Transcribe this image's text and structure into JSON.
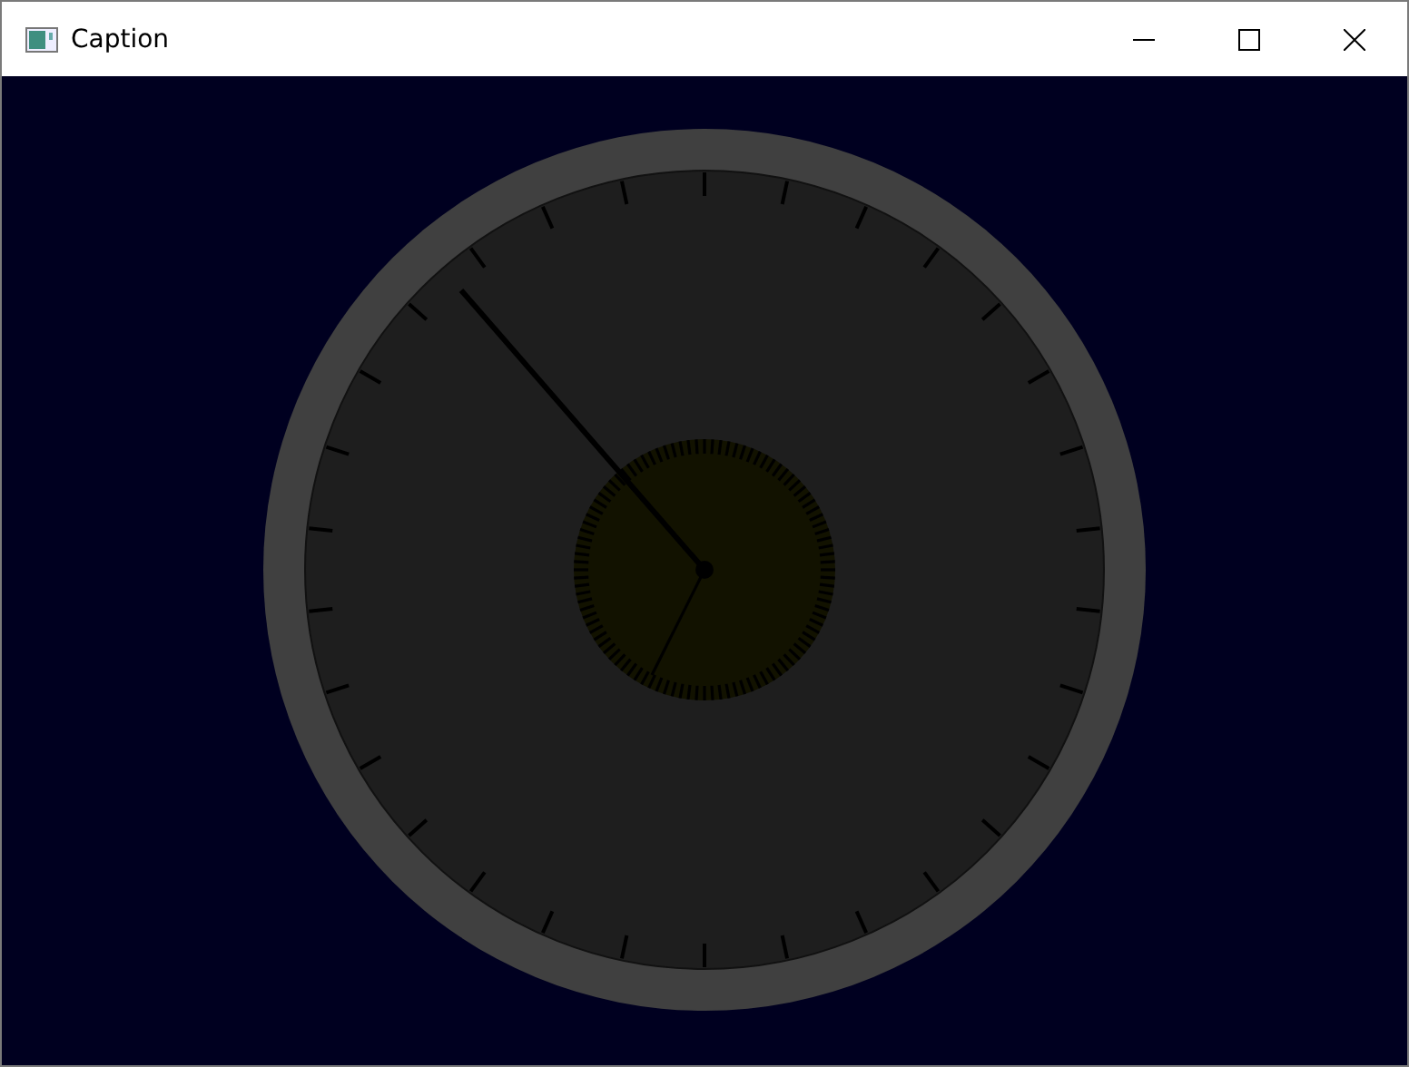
{
  "window": {
    "title": "Caption"
  }
}
